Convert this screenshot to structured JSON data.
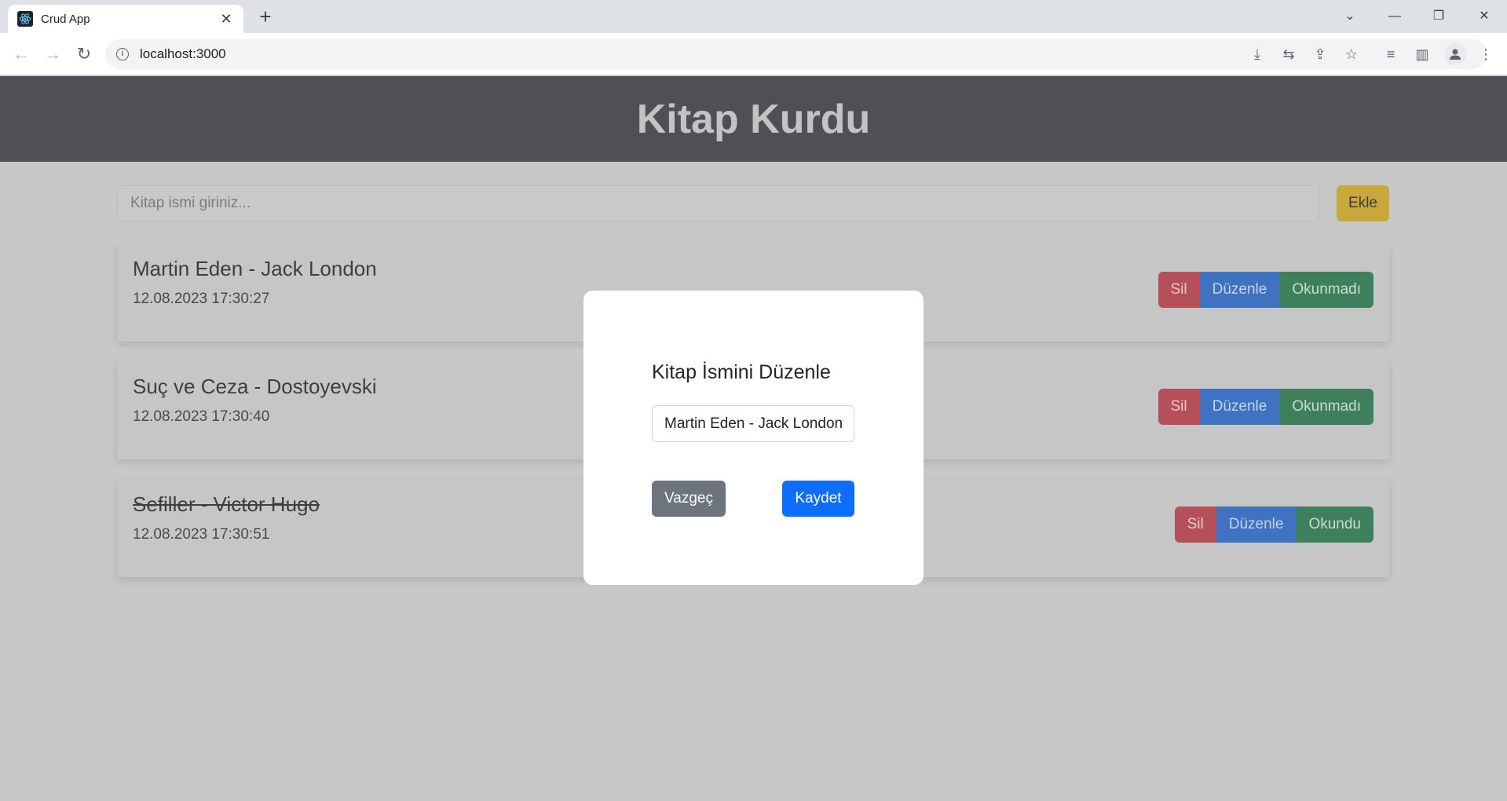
{
  "browser": {
    "tab_title": "Crud App",
    "tab_close": "✕",
    "new_tab": "+",
    "url": "localhost:3000",
    "window_controls": {
      "dropdown": "⌄",
      "minimize": "—",
      "restore": "❐",
      "close": "✕"
    },
    "nav": {
      "back": "←",
      "forward": "→",
      "reload": "↻"
    },
    "toolbar_icons": {
      "install": "⤓",
      "translate": "⇆",
      "share": "⇪",
      "bookmark": "☆",
      "reading_list": "≡",
      "side_panel": "▥",
      "menu": "⋮"
    }
  },
  "app": {
    "title": "Kitap Kurdu",
    "search": {
      "placeholder": "Kitap ismi giriniz...",
      "value": ""
    },
    "add_label": "Ekle",
    "books": [
      {
        "title": "Martin Eden - Jack London",
        "date": "12.08.2023 17:30:27",
        "read": false,
        "delete_label": "Sil",
        "edit_label": "Düzenle",
        "status_label": "Okunmadı"
      },
      {
        "title": "Suç ve Ceza - Dostoyevski",
        "date": "12.08.2023 17:30:40",
        "read": false,
        "delete_label": "Sil",
        "edit_label": "Düzenle",
        "status_label": "Okunmadı"
      },
      {
        "title": "Sefiller - Victor Hugo",
        "date": "12.08.2023 17:30:51",
        "read": true,
        "delete_label": "Sil",
        "edit_label": "Düzenle",
        "status_label": "Okundu"
      }
    ]
  },
  "modal": {
    "title": "Kitap İsmini Düzenle",
    "input_value": "Martin Eden - Jack London",
    "cancel_label": "Vazgeç",
    "save_label": "Kaydet"
  },
  "colors": {
    "header_bg": "#4e5055",
    "danger": "#b5505a",
    "primary": "#3f73c2",
    "success": "#3d805b",
    "warning": "#c8a83a",
    "modal_save": "#0d6efd",
    "modal_cancel": "#6c757d"
  }
}
